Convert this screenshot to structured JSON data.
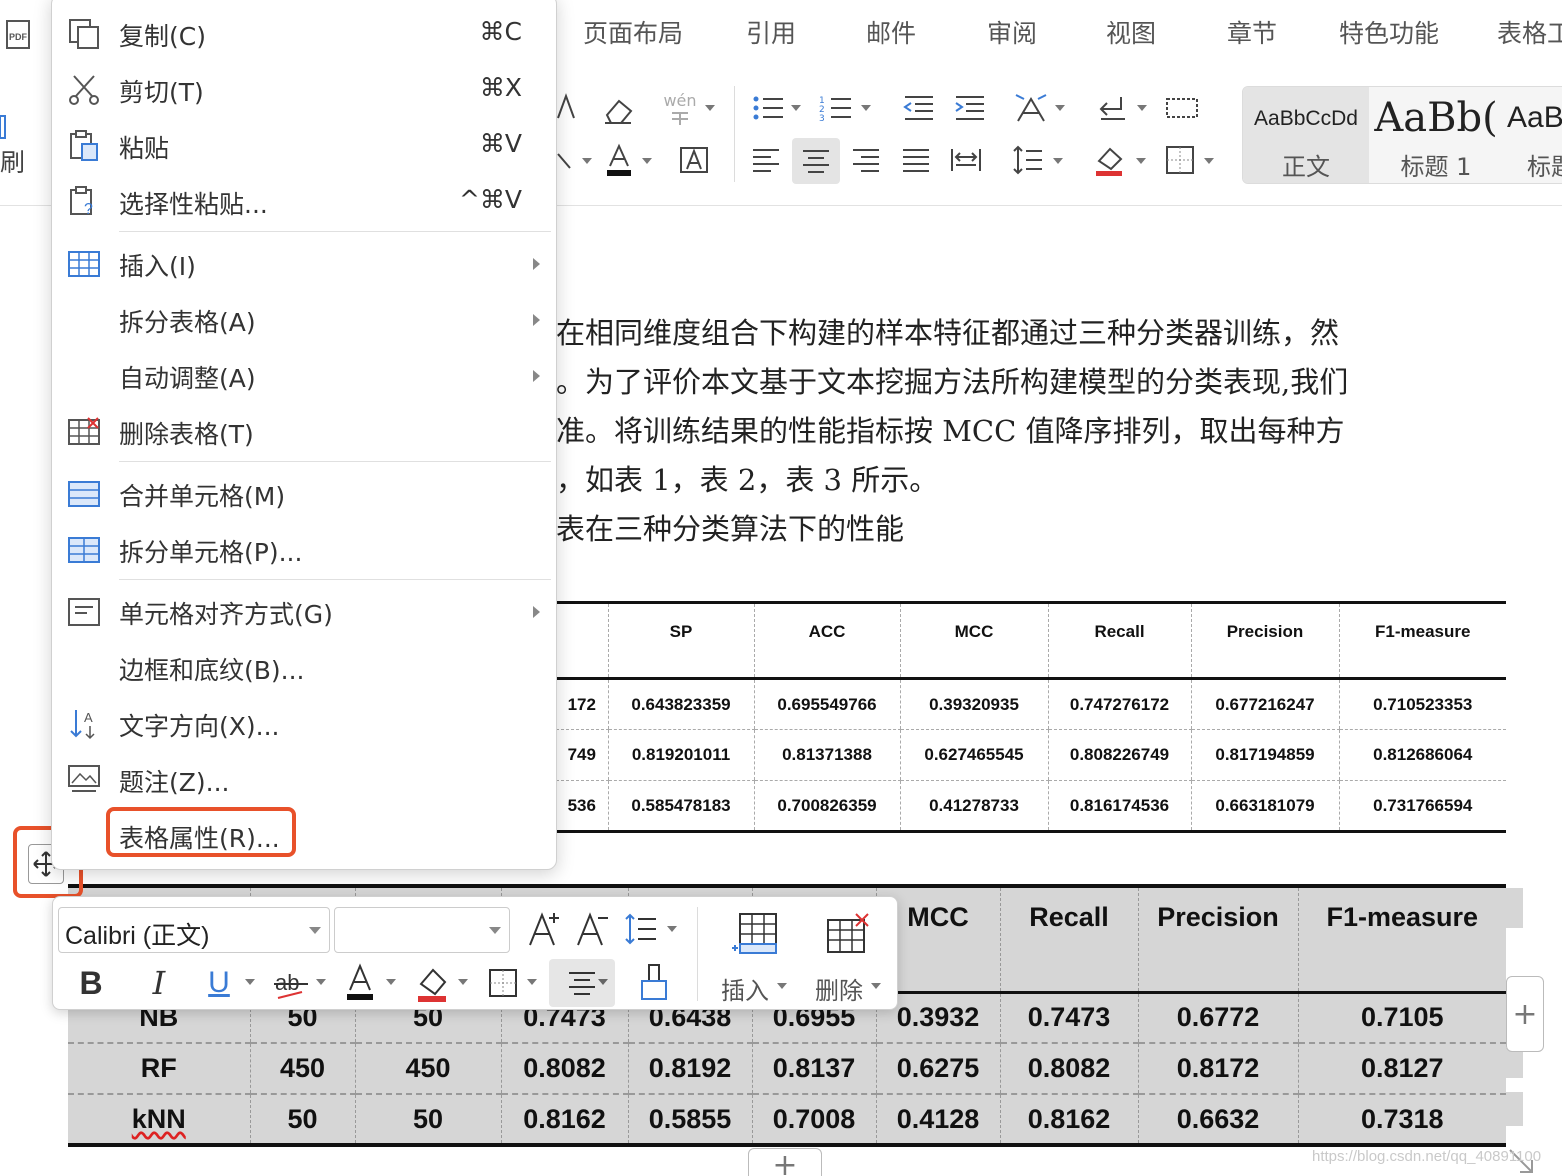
{
  "ribbon": {
    "tabs": [
      "页面布局",
      "引用",
      "邮件",
      "审阅",
      "视图",
      "章节",
      "特色功能",
      "表格工"
    ],
    "left_label": "刷",
    "styles": [
      {
        "sample": "AaBbCcDd",
        "name": "正文"
      },
      {
        "sample": "AaBb(",
        "name": "标题 1"
      },
      {
        "sample": "AaB",
        "name": "标题"
      }
    ],
    "phonetic_icon": "wén"
  },
  "document": {
    "lines": [
      "在相同维度组合下构建的样本特征都通过三种分类器训练，然",
      "。为了评价本文基于文本挖掘方法所构建模型的分类表现,我们",
      "准。将训练结果的性能指标按 MCC 值降序排列，取出每种方",
      "，如表 1，表 2，表 3 所示。",
      "表在三种分类算法下的性能"
    ]
  },
  "table_top": {
    "headers": [
      "",
      "SP",
      "ACC",
      "MCC",
      "Recall",
      "Precision",
      "F1-measure"
    ],
    "rows": [
      [
        "172",
        "0.643823359",
        "0.695549766",
        "0.39320935",
        "0.747276172",
        "0.677216247",
        "0.710523353"
      ],
      [
        "749",
        "0.819201011",
        "0.81371388",
        "0.627465545",
        "0.808226749",
        "0.817194859",
        "0.812686064"
      ],
      [
        "536",
        "0.585478183",
        "0.700826359",
        "0.41278733",
        "0.816174536",
        "0.663181079",
        "0.731766594"
      ]
    ]
  },
  "table_bottom": {
    "headers": [
      "",
      "",
      "",
      "",
      "",
      "",
      "MCC",
      "Recall",
      "Precision",
      "F1-measure"
    ],
    "rows": [
      [
        "NB",
        "50",
        "50",
        "0.7473",
        "0.6438",
        "0.6955",
        "0.3932",
        "0.7473",
        "0.6772",
        "0.7105"
      ],
      [
        "RF",
        "450",
        "450",
        "0.8082",
        "0.8192",
        "0.8137",
        "0.6275",
        "0.8082",
        "0.8172",
        "0.8127"
      ],
      [
        "kNN",
        "50",
        "50",
        "0.8162",
        "0.5855",
        "0.7008",
        "0.4128",
        "0.8162",
        "0.6632",
        "0.7318"
      ]
    ]
  },
  "context_menu": {
    "items": [
      {
        "icon": "copy-icon",
        "label": "复制(C)",
        "shortcut": "⌘C"
      },
      {
        "icon": "scissors-icon",
        "label": "剪切(T)",
        "shortcut": "⌘X"
      },
      {
        "icon": "paste-icon",
        "label": "粘贴",
        "shortcut": "⌘V"
      },
      {
        "icon": "paste-special-icon",
        "label": "选择性粘贴...",
        "shortcut": "^⌘V"
      },
      {
        "icon": "table-insert-icon",
        "label": "插入(I)"
      },
      {
        "icon": "",
        "label": "拆分表格(A)"
      },
      {
        "icon": "",
        "label": "自动调整(A)"
      },
      {
        "icon": "table-delete-icon",
        "label": "删除表格(T)"
      },
      {
        "icon": "merge-cells-icon",
        "label": "合并单元格(M)"
      },
      {
        "icon": "split-cells-icon",
        "label": "拆分单元格(P)..."
      },
      {
        "icon": "cell-align-icon",
        "label": "单元格对齐方式(G)"
      },
      {
        "icon": "",
        "label": "边框和底纹(B)..."
      },
      {
        "icon": "text-direction-icon",
        "label": "文字方向(X)..."
      },
      {
        "icon": "caption-icon",
        "label": "题注(Z)..."
      },
      {
        "icon": "",
        "label": "表格属性(R)..."
      }
    ]
  },
  "mini_toolbar": {
    "font_name": "Calibri (正文)",
    "font_size": "",
    "insert_label": "插入",
    "delete_label": "删除",
    "bold_label": "B",
    "italic_label": "I",
    "underline_label": "U"
  },
  "watermark": "https://blog.csdn.net/qq_40891100",
  "colors": {
    "highlight": "#e8512a",
    "table_shading": "#d6d6d6",
    "spellcheck": "#dd2222"
  }
}
